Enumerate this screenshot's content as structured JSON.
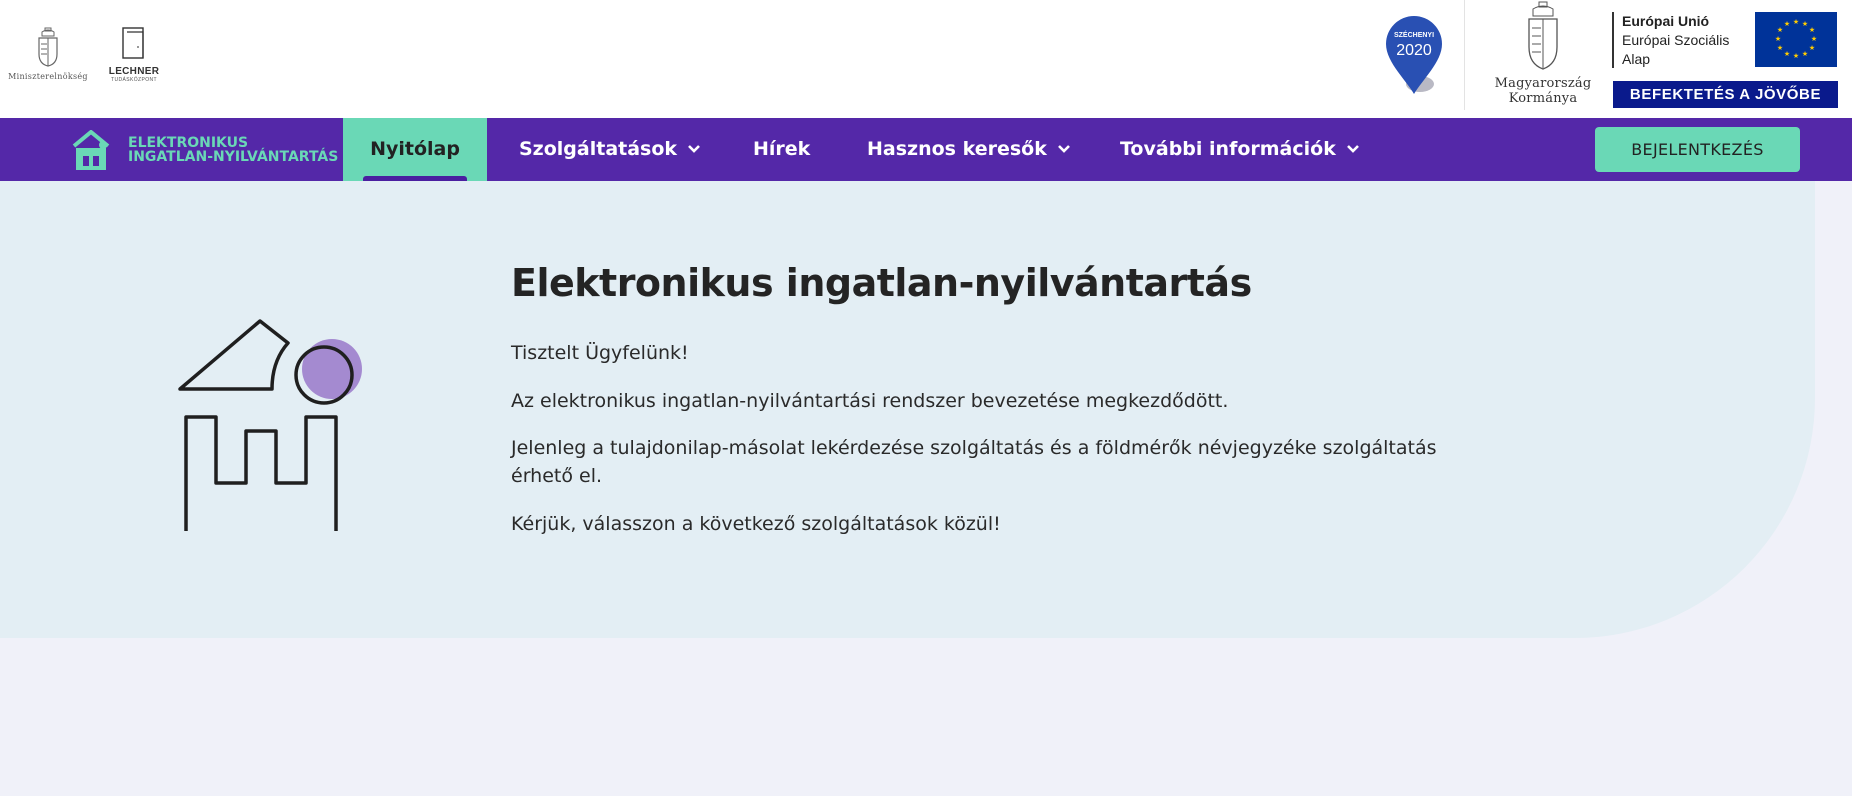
{
  "header": {
    "ministry_caption": "Miniszterelnökség",
    "lechner_name": "LECHNER",
    "lechner_sub": "TUDÁSKÖZPONT",
    "szechenyi_label": "SZÉCHENYI",
    "szechenyi_year": "2020",
    "govt_line1": "Magyarország",
    "govt_line2": "Kormánya",
    "eu_line1": "Európai Unió",
    "eu_line2": "Európai Szociális",
    "eu_line3": "Alap",
    "eu_band": "BEFEKTETÉS A JÖVŐBE",
    "eu_flag_color": "#003399"
  },
  "nav": {
    "brand_line1": "ELEKTRONIKUS",
    "brand_line2": "INGATLAN-NYILVÁNTARTÁS",
    "items": [
      {
        "label": "Nyitólap",
        "active": true
      },
      {
        "label": "Szolgáltatások",
        "dropdown": true
      },
      {
        "label": "Hírek"
      },
      {
        "label": "Hasznos keresők",
        "dropdown": true
      },
      {
        "label": "További információk",
        "dropdown": true
      }
    ],
    "login_label": "BEJELENTKEZÉS",
    "bg_color": "#5428a8",
    "accent_color": "#6ad8b6"
  },
  "hero": {
    "title": "Elektronikus ingatlan-nyilvántartás",
    "paragraphs": [
      "Tisztelt Ügyfelünk!",
      "Az elektronikus ingatlan-nyilvántartási rendszer bevezetése megkezdődött.",
      "Jelenleg a tulajdonilap-másolat lekérdezése szolgáltatás és a földmérők névjegyzéke szolgáltatás érhető el.",
      "Kérjük, válasszon a következő szolgáltatások közül!"
    ]
  }
}
